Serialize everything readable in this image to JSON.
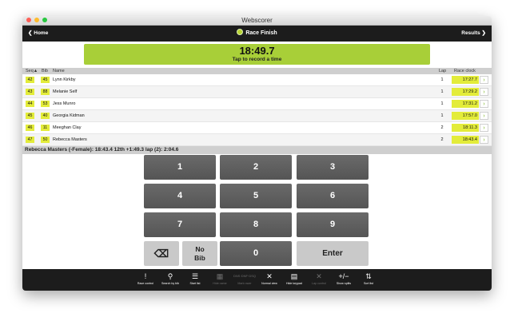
{
  "window": {
    "title": "Webscorer"
  },
  "header": {
    "home_label": "Home",
    "title": "Race Finish",
    "results_label": "Results"
  },
  "timer": {
    "time": "18:49.7",
    "subtitle": "Tap to record a time"
  },
  "columns": {
    "seq": "Seq▲",
    "bib": "Bib",
    "name": "Name",
    "lap": "Lap",
    "clock": "Race clock"
  },
  "rows": [
    {
      "seq": "42",
      "bib": "45",
      "name": "Lynn Kirkby",
      "lap": "1",
      "clock": "17:27.7"
    },
    {
      "seq": "43",
      "bib": "88",
      "name": "Melanie Self",
      "lap": "1",
      "clock": "17:29.2"
    },
    {
      "seq": "44",
      "bib": "53",
      "name": "Jess Munro",
      "lap": "1",
      "clock": "17:31.2"
    },
    {
      "seq": "45",
      "bib": "40",
      "name": "Georgia Kidman",
      "lap": "1",
      "clock": "17:57.0"
    },
    {
      "seq": "46",
      "bib": "11",
      "name": "Meeghan Clay",
      "lap": "2",
      "clock": "18:11.3"
    },
    {
      "seq": "47",
      "bib": "50",
      "name": "Rebecca Masters",
      "lap": "2",
      "clock": "18:43.4"
    }
  ],
  "status": {
    "text": "Rebecca Masters (-Female): 18:43.4 12th +1:49.3 lap (2): 2:04.6"
  },
  "keypad": {
    "k1": "1",
    "k2": "2",
    "k3": "3",
    "k4": "4",
    "k5": "5",
    "k6": "6",
    "k7": "7",
    "k8": "8",
    "k9": "9",
    "backspace": "⌫",
    "no_bib_1": "No",
    "no_bib_2": "Bib",
    "k0": "0",
    "enter": "Enter"
  },
  "toolbar": [
    {
      "icon": "!",
      "label": "Race control"
    },
    {
      "icon": "⚲",
      "label": "Search by bib"
    },
    {
      "icon": "☰",
      "label": "Start list"
    },
    {
      "icon": "▦",
      "label": "Hide name"
    },
    {
      "icon": "DNS·DNF·DSQ",
      "label": "Mark racer"
    },
    {
      "icon": "✕",
      "label": "Normal view"
    },
    {
      "icon": "▤",
      "label": "Hide keypad"
    },
    {
      "icon": "✕",
      "label": "Lap control"
    },
    {
      "icon": "+/−",
      "label": "Show splits"
    },
    {
      "icon": "⇅",
      "label": "Sort list"
    }
  ],
  "colors": {
    "accent": "#a8cf38",
    "highlight": "#e3ec3a",
    "header": "#1c1c1c"
  }
}
